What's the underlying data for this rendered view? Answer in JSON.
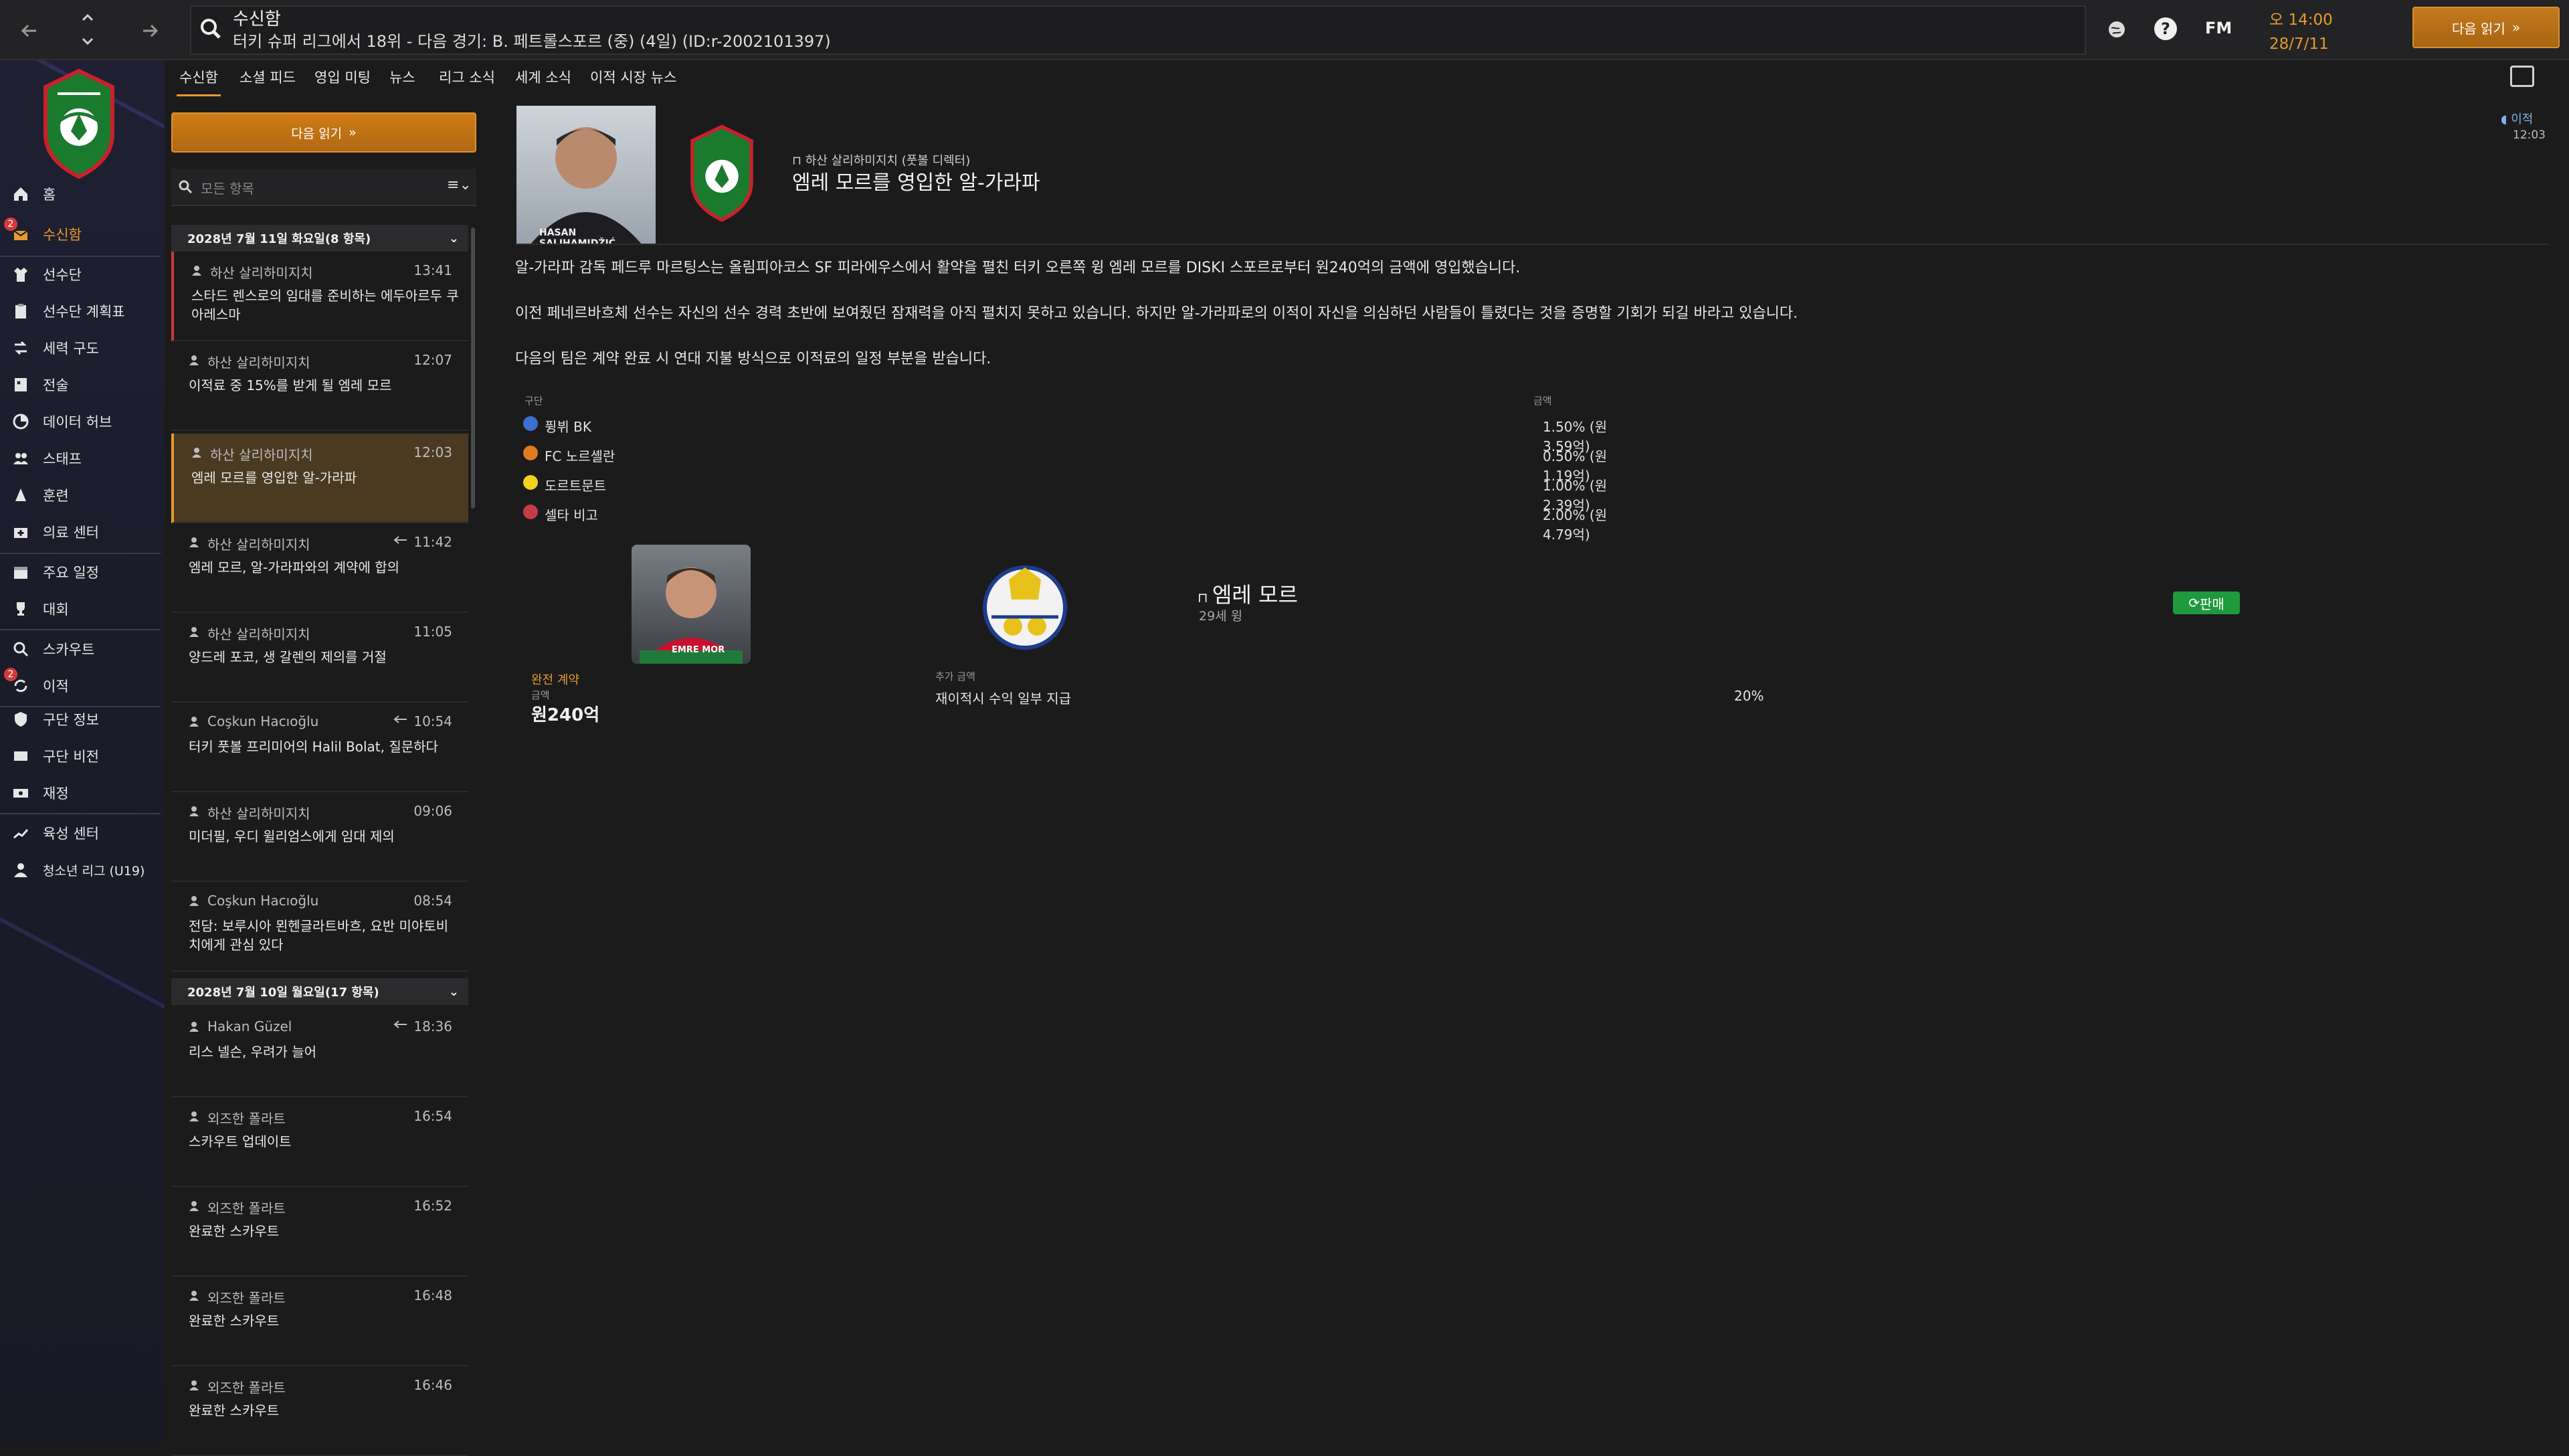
{
  "topbar": {
    "title": "수신함",
    "subtitle": "터키 슈퍼 리그에서 18위 - 다음 경기: B. 페트롤스포르 (중) (4일) (ID:r-2002101397)",
    "fm_label": "FM",
    "time": "오 14:00",
    "date": "28/7/11",
    "continue_label": "다음 읽기"
  },
  "sidebar": {
    "items": [
      {
        "label": "홈"
      },
      {
        "label": "수신함",
        "badge": "2"
      },
      {
        "label": "선수단"
      },
      {
        "label": "선수단 계획표"
      },
      {
        "label": "세력 구도"
      },
      {
        "label": "전술"
      },
      {
        "label": "데이터 허브"
      },
      {
        "label": "스태프"
      },
      {
        "label": "훈련"
      },
      {
        "label": "의료 센터"
      },
      {
        "label": "주요 일정"
      },
      {
        "label": "대회"
      },
      {
        "label": "스카우트"
      },
      {
        "label": "이적",
        "badge": "2"
      },
      {
        "label": "구단 정보"
      },
      {
        "label": "구단 비전"
      },
      {
        "label": "재정"
      },
      {
        "label": "육성 센터"
      },
      {
        "label": "청소년 리그 (U19)"
      }
    ]
  },
  "tabs": [
    "수신함",
    "소셜 피드",
    "영입 미팅",
    "뉴스",
    "리그 소식",
    "세계 소식",
    "이적 시장 뉴스"
  ],
  "list": {
    "read_label": "다음 읽기",
    "filter_placeholder": "모든 항목",
    "group1": "2028년 7월 11일 화요일(8 항목)",
    "group2": "2028년 7월 10일 월요일(17 항목)",
    "messages_day1": [
      {
        "from": "하산 살리하미지치",
        "time": "13:41",
        "subject": "스타드 렌스로의 임대를 준비하는 에두아르두 쿠아레스마"
      },
      {
        "from": "하산 살리하미지치",
        "time": "12:07",
        "subject": "이적료 중 15%를 받게 될 엠레 모르"
      },
      {
        "from": "하산 살리하미지치",
        "time": "12:03",
        "subject": "엠레 모르를 영입한 알-가라파"
      },
      {
        "from": "하산 살리하미지치",
        "time": "11:42",
        "subject": "엠레 모르, 알-가라파와의 계약에 합의"
      },
      {
        "from": "하산 살리하미지치",
        "time": "11:05",
        "subject": "양드레 포코, 생 갈렌의 제의를 거절"
      },
      {
        "from": "Coşkun Hacıoğlu",
        "time": "10:54",
        "subject": "터키 풋볼 프리미어의 Halil Bolat, 질문하다"
      },
      {
        "from": "하산 살리하미지치",
        "time": "09:06",
        "subject": "미더필, 우디 윌리엄스에게 임대 제의"
      },
      {
        "from": "Coşkun Hacıoğlu",
        "time": "08:54",
        "subject": "전담: 보루시아 묀헨글라트바흐, 요반 미야토비치에게 관심 있다"
      }
    ],
    "messages_day2": [
      {
        "from": "Hakan Güzel",
        "time": "18:36",
        "subject": "리스 넬슨, 우려가 늘어"
      },
      {
        "from": "외즈한 폴라트",
        "time": "16:54",
        "subject": "스카우트 업데이트"
      },
      {
        "from": "외즈한 폴라트",
        "time": "16:52",
        "subject": "완료한 스카우트"
      },
      {
        "from": "외즈한 폴라트",
        "time": "16:48",
        "subject": "완료한 스카우트"
      },
      {
        "from": "외즈한 폴라트",
        "time": "16:46",
        "subject": "완료한 스카우트"
      }
    ]
  },
  "message": {
    "sender_role": "하산 살리하미지치 (풋볼 디렉터)",
    "headline": "엠레 모르를 영입한 알-가라파",
    "photo_caption": "HASAN SALIHAMIDŽIĆ",
    "tag": "이적",
    "tag_time": "12:03",
    "paragraphs": [
      "알-가라파 감독 페드루 마르팅스는 올림피아코스 SF 피라에우스에서 활약을 펼친 터키 오른쪽 윙 엠레 모르를 DISKI 스포르로부터 원240억의 금액에 영입했습니다.",
      "이전 페네르바흐체 선수는 자신의 선수 경력 초반에 보여줬던 잠재력을 아직 펼치지 못하고 있습니다. 하지만 알-가라파로의 이적이 자신을 의심하던 사람들이 틀렸다는 것을 증명할 기회가 되길 바라고 있습니다.",
      "다음의 팀은 계약 완료 시 연대 지불 방식으로 이적료의 일정 부분을 받습니다."
    ],
    "fee_header_club": "구단",
    "fee_header_amount": "금액",
    "fees": [
      {
        "club": "퓡뷔 BK",
        "amount": "1.50% (원3.59억)",
        "color": "#3b6fd0"
      },
      {
        "club": "FC 노르셸란",
        "amount": "0.50% (원1.19억)",
        "color": "#e07a1f"
      },
      {
        "club": "도르트문트",
        "amount": "1.00% (원2.39억)",
        "color": "#f2d21b"
      },
      {
        "club": "셀타 비고",
        "amount": "2.00% (원4.79억)",
        "color": "#c43c48"
      }
    ],
    "player_name": "엠레 모르",
    "player_age": "29세 윙",
    "player_shirt": "EMRE MOR",
    "deal_badge": "판매",
    "deal_type": "완전 계약",
    "amount_label": "금액",
    "amount_value": "원240억",
    "extra_label": "추가 금액",
    "extra_desc": "재이적시 수익 일부 지급",
    "extra_pct": "20%"
  }
}
